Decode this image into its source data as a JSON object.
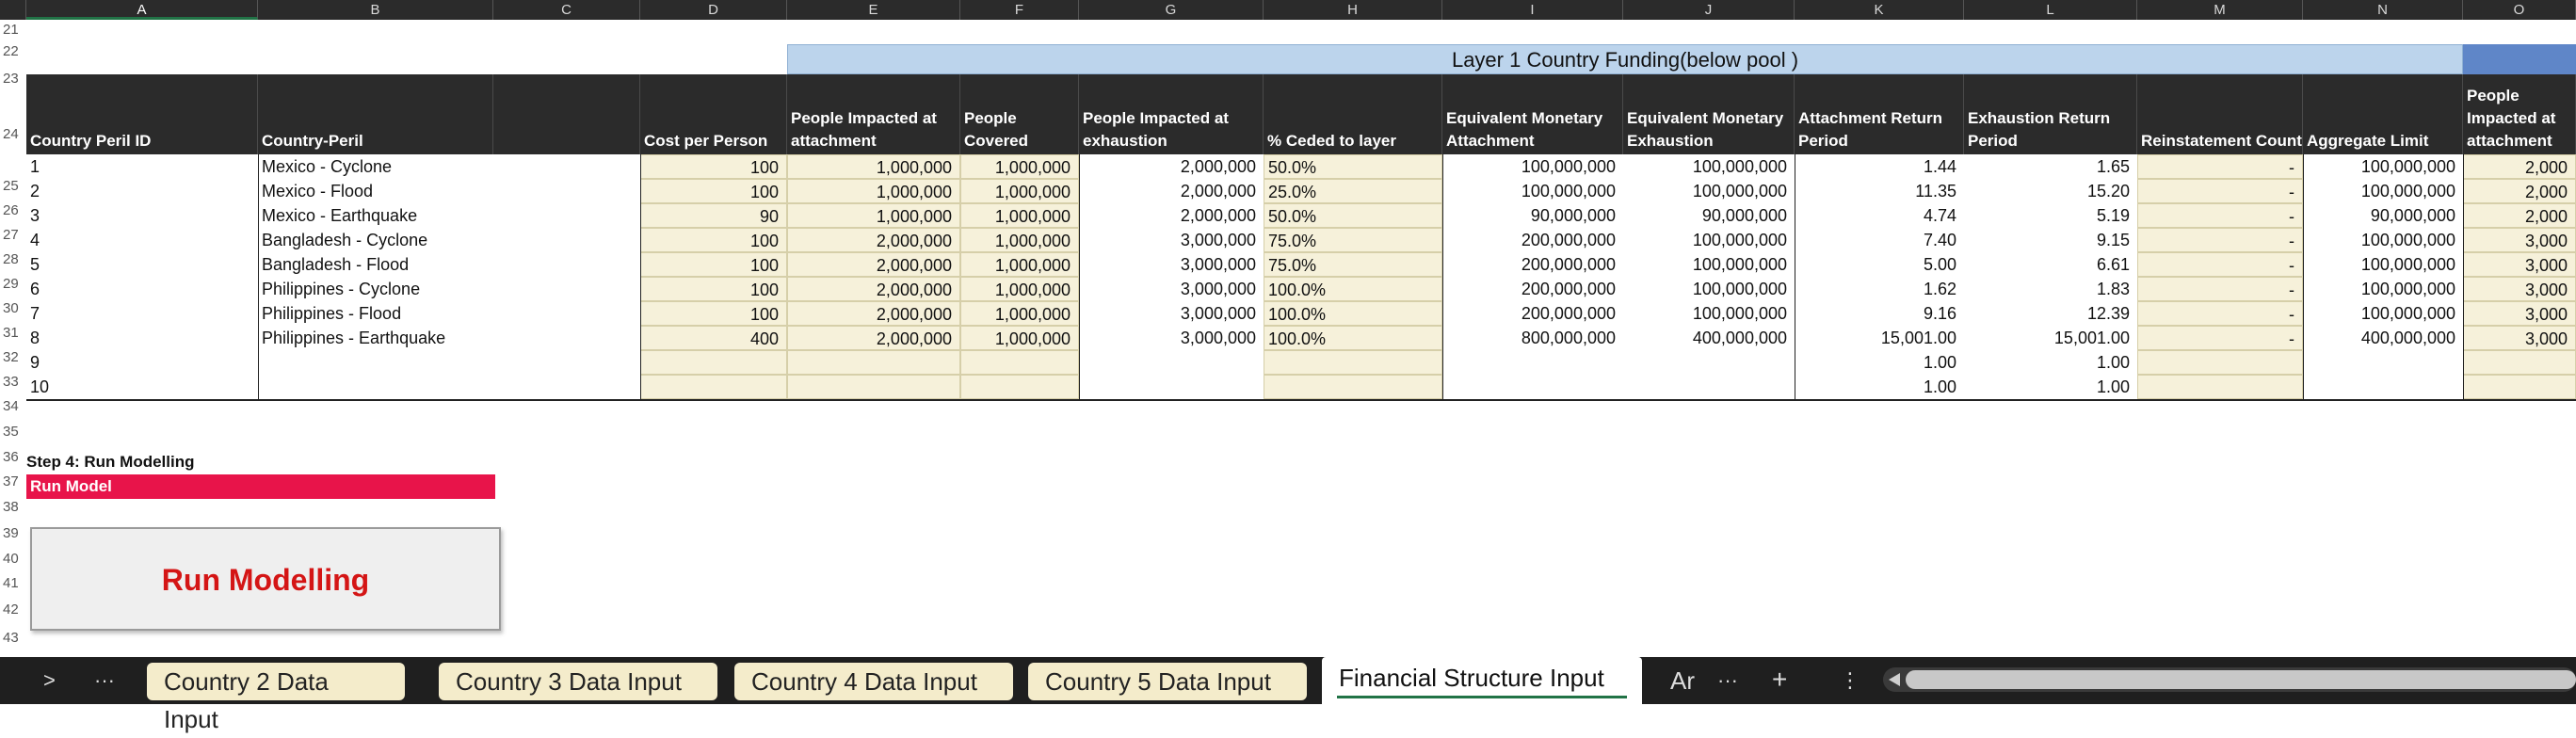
{
  "columns": [
    "A",
    "B",
    "C",
    "D",
    "E",
    "F",
    "G",
    "H",
    "I",
    "J",
    "K",
    "L",
    "M",
    "N",
    "O"
  ],
  "row_numbers": [
    "21",
    "22",
    "23",
    "24",
    "25",
    "26",
    "27",
    "28",
    "29",
    "30",
    "31",
    "32",
    "33",
    "34",
    "35",
    "36",
    "37",
    "38",
    "39",
    "40",
    "41",
    "42",
    "43"
  ],
  "title_band": "Layer 1 Country Funding(below pool )",
  "headers": {
    "A": "Country Peril ID",
    "B": "Country-Peril",
    "D": "Cost per Person",
    "E": "People Impacted at attachment",
    "F": "People Covered",
    "G": "People Impacted at exhaustion",
    "H": "% Ceded to layer",
    "I": "Equivalent Monetary Attachment",
    "J": "Equivalent Monetary Exhaustion",
    "K": "Attachment Return Period",
    "L": "Exhaustion Return Period",
    "M": "Reinstatement Count",
    "N": "Aggregate Limit",
    "O": "People Impacted at attachment"
  },
  "rows": [
    {
      "id": "1",
      "name": "Mexico - Cyclone",
      "cost": "100",
      "e": "1,000,000",
      "f": "1,000,000",
      "g": "2,000,000",
      "h": "50.0%",
      "i": "100,000,000",
      "j": "100,000,000",
      "k": "1.44",
      "l": "1.65",
      "m": "-",
      "n": "100,000,000",
      "o": "2,000"
    },
    {
      "id": "2",
      "name": "Mexico - Flood",
      "cost": "100",
      "e": "1,000,000",
      "f": "1,000,000",
      "g": "2,000,000",
      "h": "25.0%",
      "i": "100,000,000",
      "j": "100,000,000",
      "k": "11.35",
      "l": "15.20",
      "m": "-",
      "n": "100,000,000",
      "o": "2,000"
    },
    {
      "id": "3",
      "name": "Mexico - Earthquake",
      "cost": "90",
      "e": "1,000,000",
      "f": "1,000,000",
      "g": "2,000,000",
      "h": "50.0%",
      "i": "90,000,000",
      "j": "90,000,000",
      "k": "4.74",
      "l": "5.19",
      "m": "-",
      "n": "90,000,000",
      "o": "2,000"
    },
    {
      "id": "4",
      "name": "Bangladesh - Cyclone",
      "cost": "100",
      "e": "2,000,000",
      "f": "1,000,000",
      "g": "3,000,000",
      "h": "75.0%",
      "i": "200,000,000",
      "j": "100,000,000",
      "k": "7.40",
      "l": "9.15",
      "m": "-",
      "n": "100,000,000",
      "o": "3,000"
    },
    {
      "id": "5",
      "name": "Bangladesh - Flood",
      "cost": "100",
      "e": "2,000,000",
      "f": "1,000,000",
      "g": "3,000,000",
      "h": "75.0%",
      "i": "200,000,000",
      "j": "100,000,000",
      "k": "5.00",
      "l": "6.61",
      "m": "-",
      "n": "100,000,000",
      "o": "3,000"
    },
    {
      "id": "6",
      "name": "Philippines - Cyclone",
      "cost": "100",
      "e": "2,000,000",
      "f": "1,000,000",
      "g": "3,000,000",
      "h": "100.0%",
      "i": "200,000,000",
      "j": "100,000,000",
      "k": "1.62",
      "l": "1.83",
      "m": "-",
      "n": "100,000,000",
      "o": "3,000"
    },
    {
      "id": "7",
      "name": "Philippines - Flood",
      "cost": "100",
      "e": "2,000,000",
      "f": "1,000,000",
      "g": "3,000,000",
      "h": "100.0%",
      "i": "200,000,000",
      "j": "100,000,000",
      "k": "9.16",
      "l": "12.39",
      "m": "-",
      "n": "100,000,000",
      "o": "3,000"
    },
    {
      "id": "8",
      "name": "Philippines - Earthquake",
      "cost": "400",
      "e": "2,000,000",
      "f": "1,000,000",
      "g": "3,000,000",
      "h": "100.0%",
      "i": "800,000,000",
      "j": "400,000,000",
      "k": "15,001.00",
      "l": "15,001.00",
      "m": "-",
      "n": "400,000,000",
      "o": "3,000"
    },
    {
      "id": "9",
      "name": "",
      "cost": "",
      "e": "",
      "f": "",
      "g": "",
      "h": "",
      "i": "",
      "j": "",
      "k": "1.00",
      "l": "1.00",
      "m": "",
      "n": "",
      "o": ""
    },
    {
      "id": "10",
      "name": "",
      "cost": "",
      "e": "",
      "f": "",
      "g": "",
      "h": "",
      "i": "",
      "j": "",
      "k": "1.00",
      "l": "1.00",
      "m": "",
      "n": "",
      "o": ""
    }
  ],
  "step4_label": "Step 4: Run Modelling",
  "run_model_label": "Run Model",
  "run_button_label": "Run Modelling",
  "tabs": [
    {
      "label": "Country 2 Data Input"
    },
    {
      "label": "Country 3 Data Input"
    },
    {
      "label": "Country 4 Data Input"
    },
    {
      "label": "Country 5 Data Input"
    },
    {
      "label": "Financial Structure Input"
    },
    {
      "label": "Ar"
    }
  ],
  "nav": {
    "next": ">",
    "more": "···",
    "add": "+",
    "options": "⋮",
    "more_sheets": "···"
  }
}
